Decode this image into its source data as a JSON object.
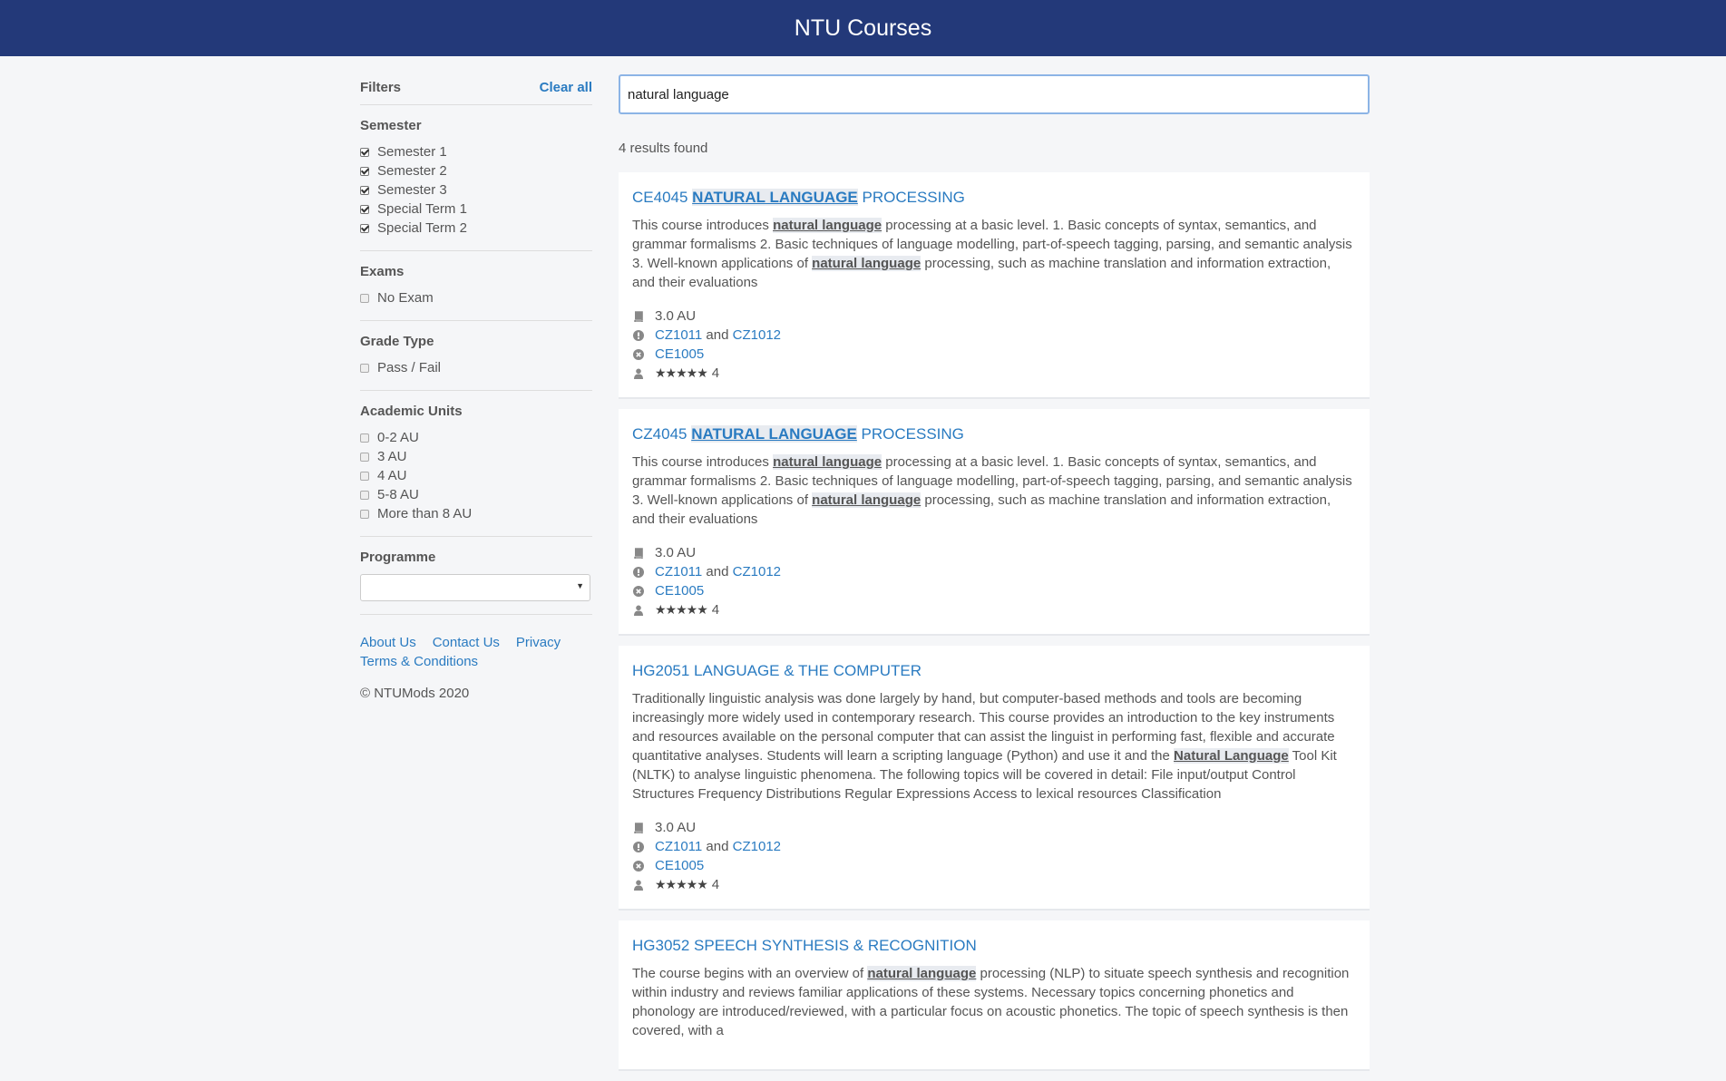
{
  "header": {
    "title": "NTU Courses"
  },
  "filters": {
    "title": "Filters",
    "clear_label": "Clear all",
    "semester": {
      "title": "Semester",
      "options": [
        {
          "label": "Semester 1",
          "checked": true
        },
        {
          "label": "Semester 2",
          "checked": true
        },
        {
          "label": "Semester 3",
          "checked": true
        },
        {
          "label": "Special Term 1",
          "checked": true
        },
        {
          "label": "Special Term 2",
          "checked": true
        }
      ]
    },
    "exams": {
      "title": "Exams",
      "options": [
        {
          "label": "No Exam",
          "checked": false
        }
      ]
    },
    "grade_type": {
      "title": "Grade Type",
      "options": [
        {
          "label": "Pass / Fail",
          "checked": false
        }
      ]
    },
    "academic_units": {
      "title": "Academic Units",
      "options": [
        {
          "label": "0-2 AU",
          "checked": false
        },
        {
          "label": "3 AU",
          "checked": false
        },
        {
          "label": "4 AU",
          "checked": false
        },
        {
          "label": "5-8 AU",
          "checked": false
        },
        {
          "label": "More than 8 AU",
          "checked": false
        }
      ]
    },
    "programme": {
      "title": "Programme",
      "selected": ""
    }
  },
  "footer": {
    "about": "About Us",
    "contact": "Contact Us",
    "privacy": "Privacy",
    "terms": "Terms & Conditions",
    "copyright": "© NTUMods 2020"
  },
  "search": {
    "value": "natural language"
  },
  "results_count": "4 results found",
  "results": [
    {
      "code": "CE4045",
      "title_highlight": "NATURAL LANGUAGE",
      "title_rest": "PROCESSING",
      "desc": [
        {
          "t": "This course introduces "
        },
        {
          "t": "natural language",
          "h": true
        },
        {
          "t": " processing at a basic level. 1. Basic concepts of syntax, semantics, and grammar formalisms 2. Basic techniques of language modelling, part-of-speech tagging, parsing, and semantic analysis 3. Well-known applications of "
        },
        {
          "t": "natural language",
          "h": true
        },
        {
          "t": " processing, such as machine translation and information extraction, and their evaluations"
        }
      ],
      "au": "3.0 AU",
      "prereq1": "CZ1011",
      "prereq_and": "and",
      "prereq2": "CZ1012",
      "mutex": "CE1005",
      "stars": "★★★★★",
      "rating": "4"
    },
    {
      "code": "CZ4045",
      "title_highlight": "NATURAL LANGUAGE",
      "title_rest": "PROCESSING",
      "desc": [
        {
          "t": "This course introduces "
        },
        {
          "t": "natural language",
          "h": true
        },
        {
          "t": " processing at a basic level. 1. Basic concepts of syntax, semantics, and grammar formalisms 2. Basic techniques of language modelling, part-of-speech tagging, parsing, and semantic analysis 3. Well-known applications of "
        },
        {
          "t": "natural language",
          "h": true
        },
        {
          "t": " processing, such as machine translation and information extraction, and their evaluations"
        }
      ],
      "au": "3.0 AU",
      "prereq1": "CZ1011",
      "prereq_and": "and",
      "prereq2": "CZ1012",
      "mutex": "CE1005",
      "stars": "★★★★★",
      "rating": "4"
    },
    {
      "code": "HG2051",
      "title_highlight": "",
      "title_rest": "LANGUAGE & THE COMPUTER",
      "desc": [
        {
          "t": "Traditionally linguistic analysis was done largely by hand, but computer-based methods and tools are becoming increasingly more widely used in contemporary research. This course provides an introduction to the key instruments and resources available on the personal computer that can assist the linguist in performing fast, flexible and accurate quantitative analyses. Students will learn a scripting language (Python) and use it and the "
        },
        {
          "t": "Natural Language",
          "h": true
        },
        {
          "t": " Tool Kit (NLTK) to analyse linguistic phenomena. The following topics will be covered in detail: File input/output Control Structures Frequency Distributions Regular Expressions Access to lexical resources Classification"
        }
      ],
      "au": "3.0 AU",
      "prereq1": "CZ1011",
      "prereq_and": "and",
      "prereq2": "CZ1012",
      "mutex": "CE1005",
      "stars": "★★★★★",
      "rating": "4"
    },
    {
      "code": "HG3052",
      "title_highlight": "",
      "title_rest": "SPEECH SYNTHESIS & RECOGNITION",
      "desc": [
        {
          "t": "The course begins with an overview of "
        },
        {
          "t": "natural language",
          "h": true
        },
        {
          "t": " processing (NLP) to situate speech synthesis and recognition within industry and reviews familiar applications of these systems. Necessary topics concerning phonetics and phonology are introduced/reviewed, with a particular focus on acoustic phonetics. The topic of speech synthesis is then covered, with a"
        }
      ]
    }
  ]
}
